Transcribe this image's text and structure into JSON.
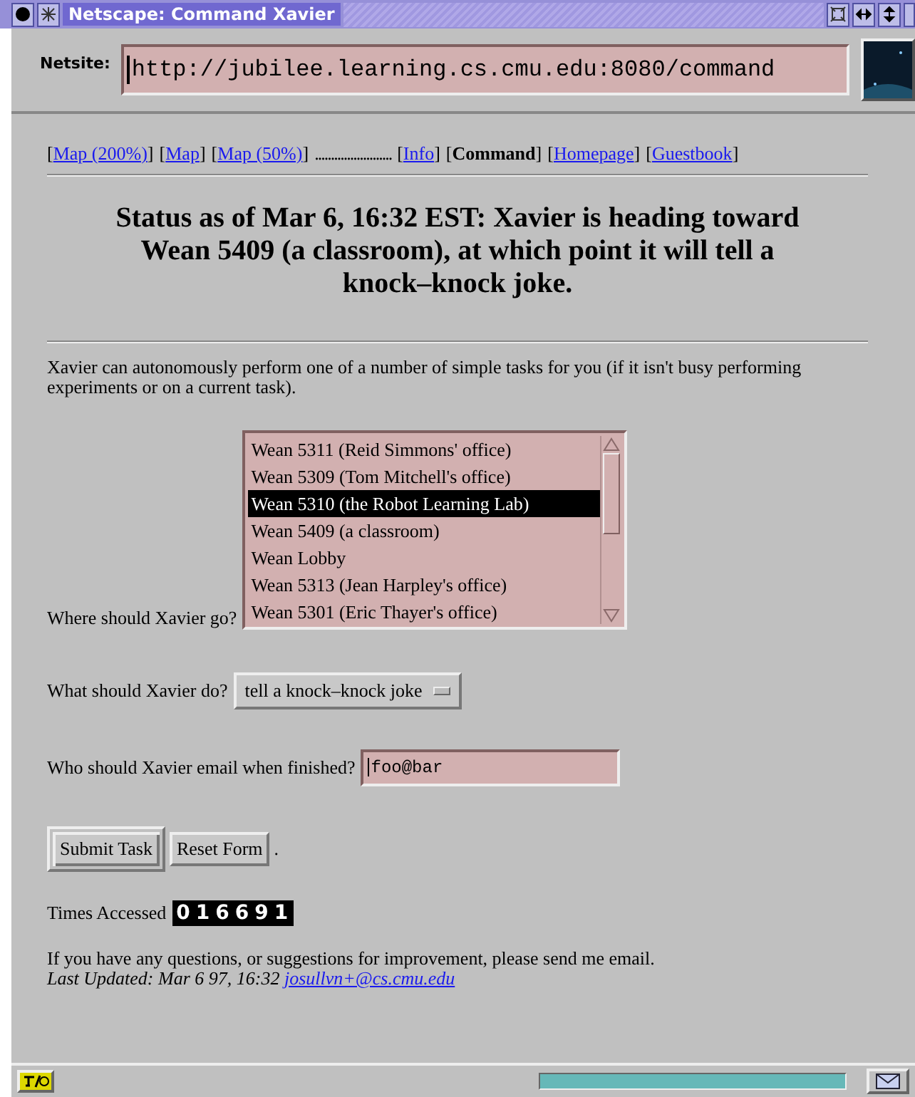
{
  "window": {
    "title": "Netscape: Command Xavier"
  },
  "location": {
    "label": "Netsite:",
    "value": "http://jubilee.learning.cs.cmu.edu:8080/command"
  },
  "nav": [
    {
      "open": "[",
      "label": "Map (200%)",
      "close": "]",
      "kind": "link"
    },
    {
      "open": "[",
      "label": "Map",
      "close": "]",
      "kind": "link"
    },
    {
      "open": "[",
      "label": "Map (50%)",
      "close": "]",
      "kind": "link"
    },
    {
      "label": "........................",
      "kind": "filler"
    },
    {
      "open": "[",
      "label": "Info",
      "close": "]",
      "kind": "link"
    },
    {
      "open": "[",
      "label": "Command",
      "close": "]",
      "kind": "current"
    },
    {
      "open": "[",
      "label": "Homepage",
      "close": "]",
      "kind": "link"
    },
    {
      "open": "[",
      "label": "Guestbook",
      "close": "]",
      "kind": "link"
    }
  ],
  "heading": "Status as of Mar 6, 16:32 EST: Xavier is heading toward Wean 5409 (a classroom), at which point it will tell a knock–knock joke.",
  "intro": "Xavier can autonomously perform one of a number of simple tasks for you (if it isn't busy performing experiments or on a current task).",
  "destination": {
    "label": "Where should Xavier go?",
    "options": [
      {
        "label": "Wean 5311 (Reid Simmons' office)",
        "selected": false
      },
      {
        "label": "Wean 5309 (Tom Mitchell's office)",
        "selected": false
      },
      {
        "label": "Wean 5310 (the Robot Learning Lab)",
        "selected": true
      },
      {
        "label": "Wean 5409 (a classroom)",
        "selected": false
      },
      {
        "label": "Wean Lobby",
        "selected": false
      },
      {
        "label": "Wean 5313 (Jean Harpley's office)",
        "selected": false
      },
      {
        "label": "Wean 5301 (Eric Thayer's office)",
        "selected": false
      }
    ]
  },
  "task": {
    "label": "What should Xavier do?",
    "value": "tell a knock–knock joke"
  },
  "email": {
    "label": "Who should Xavier email when finished?",
    "value": "foo@bar"
  },
  "buttons": [
    {
      "label": "Submit Task",
      "default": true
    },
    {
      "label": "Reset Form",
      "default": false
    }
  ],
  "buttons_trailer": ".",
  "counter": {
    "label": "Times Accessed",
    "value": "016691"
  },
  "footer": {
    "text": "If you have any questions, or suggestions for improvement, please send me email.",
    "updated": "Last Updated: Mar 6 97, 16:32",
    "email": "josullvn+@cs.cmu.edu"
  },
  "status_bar": {
    "progress": {
      "level": 1
    }
  }
}
